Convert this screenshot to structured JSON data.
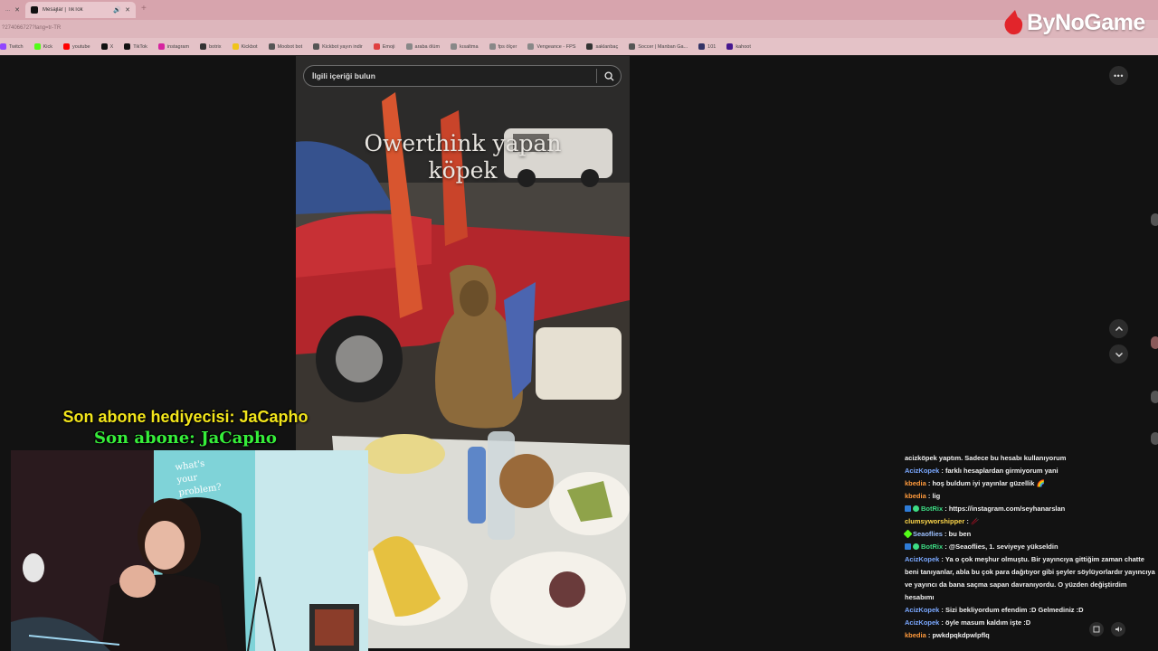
{
  "browser": {
    "prev_tab_label": "... ",
    "active_tab_title": "Mesajlar | TikTok",
    "address": "?274066727?lang=tr-TR",
    "bookmarks": [
      {
        "label": "Twitch",
        "color": "#9146ff"
      },
      {
        "label": "Kick",
        "color": "#53fc18"
      },
      {
        "label": "youtube",
        "color": "#ff0000"
      },
      {
        "label": "X",
        "color": "#111111"
      },
      {
        "label": "TikTok",
        "color": "#111111"
      },
      {
        "label": "instagram",
        "color": "#d6249f"
      },
      {
        "label": "botrix",
        "color": "#333333"
      },
      {
        "label": "Kickbot",
        "color": "#f0c419"
      },
      {
        "label": "Moobot bot",
        "color": "#555555"
      },
      {
        "label": "Kickbot yayın indir",
        "color": "#555555"
      },
      {
        "label": "Emoji",
        "color": "#e04040"
      },
      {
        "label": "araba ölüm",
        "color": "#888888"
      },
      {
        "label": "kısaltma",
        "color": "#888888"
      },
      {
        "label": "fps ölçer",
        "color": "#888888"
      },
      {
        "label": "Vengeance - FPS",
        "color": "#888888"
      },
      {
        "label": "saklanbaç",
        "color": "#333333"
      },
      {
        "label": "Soccer | Manban Ga...",
        "color": "#555555"
      },
      {
        "label": "101",
        "color": "#333366"
      },
      {
        "label": "kahoot",
        "color": "#46178f"
      }
    ]
  },
  "brand": {
    "logo_text": "ByNoGame"
  },
  "tiktok": {
    "search_placeholder": "İlgili içeriği bulun",
    "caption_line1": "Owerthink yapan",
    "caption_line2": "köpek",
    "more_label": "•••"
  },
  "overlay": {
    "line1": "Son abone hediyecisi: JaCapho",
    "line2": "Son abone: JaCapho"
  },
  "chat": {
    "messages": [
      {
        "user": "",
        "user_color": "#8fb4ff",
        "text": "acizköpek yaptım. Sadece bu hesabı kullanıyorum",
        "badge": null
      },
      {
        "user": "AcizKopek",
        "user_color": "#7aa8ff",
        "text": "farklı hesaplardan girmiyorum yani",
        "badge": null
      },
      {
        "user": "kbedia",
        "user_color": "#ff9a3c",
        "text": "hoş buldum iyi yayınlar güzellik 🌈",
        "badge": null
      },
      {
        "user": "kbedia",
        "user_color": "#ff9a3c",
        "text": "lig",
        "badge": null
      },
      {
        "user": "BotRix",
        "user_color": "#3ddc84",
        "text": "https://instagram.com/seyhanarslan",
        "badge": "bot"
      },
      {
        "user": "clumsyworshipper",
        "user_color": "#ffd84a",
        "text": "🥢",
        "badge": null
      },
      {
        "user": "Seaoflies",
        "user_color": "#9cc0ff",
        "text": "bu ben",
        "badge": "gift"
      },
      {
        "user": "BotRix",
        "user_color": "#3ddc84",
        "text": "@Seaoflies, 1. seviyeye yükseldin",
        "badge": "bot"
      },
      {
        "user": "AcizKopek",
        "user_color": "#7aa8ff",
        "text": "Ya o çok meşhur olmuştu. Bir yayıncıya gittiğim zaman chatte beni tanıyanlar, abla bu çok para dağıtıyor gibi şeyler söylüyorlardır yayıncıya ve yayıncı da bana saçma sapan davranıyordu. O yüzden değiştirdim hesabımı",
        "badge": null
      },
      {
        "user": "AcizKopek",
        "user_color": "#7aa8ff",
        "text": "Sizi bekliyordum efendim :D Gelmediniz :D",
        "badge": null
      },
      {
        "user": "AcizKopek",
        "user_color": "#7aa8ff",
        "text": "öyle masum kaldım işte :D",
        "badge": null
      },
      {
        "user": "kbedia",
        "user_color": "#ff9a3c",
        "text": "pwkdpqkdpwlpflq",
        "badge": null
      }
    ]
  }
}
